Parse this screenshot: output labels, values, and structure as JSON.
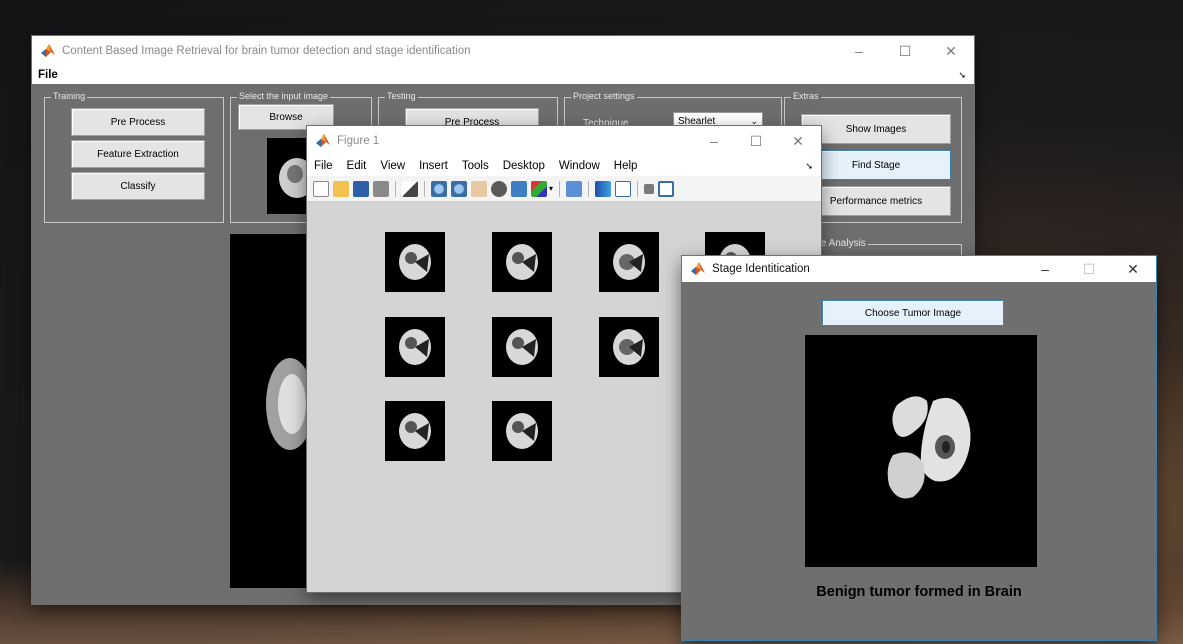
{
  "main_window": {
    "title": "Content Based Image Retrieval for brain tumor detection and stage identification",
    "menu": [
      "File"
    ],
    "training": {
      "label": "Training",
      "buttons": [
        "Pre Process",
        "Feature Extraction",
        "Classify"
      ]
    },
    "select_input": {
      "label": "Select the input image",
      "browse_label": "Browse"
    },
    "testing": {
      "label": "Testing",
      "pre_process_label": "Pre Process"
    },
    "project_settings": {
      "label": "Project settings",
      "technique_label": "Technique",
      "technique_value": "Shearlet"
    },
    "extras": {
      "label": "Extras",
      "buttons": [
        "Show Images",
        "Find Stage",
        "Performance metrics"
      ]
    },
    "performance_analysis_label": "rmance Analysis"
  },
  "figure_window": {
    "title": "Figure 1",
    "menu": [
      "File",
      "Edit",
      "View",
      "Insert",
      "Tools",
      "Desktop",
      "Window",
      "Help"
    ]
  },
  "stage_window": {
    "title": "Stage Identitication",
    "choose_button": "Choose Tumor Image",
    "result": "Benign tumor formed in Brain"
  },
  "window_controls": {
    "minimize": "–",
    "maximize": "☐",
    "close": "✕"
  },
  "colors": {
    "canvas_gray": "#6e6e6e",
    "figure_bg": "#d4d4d4",
    "selected_button": "#e5f1fb",
    "accent_blue": "#3c7fb1"
  }
}
